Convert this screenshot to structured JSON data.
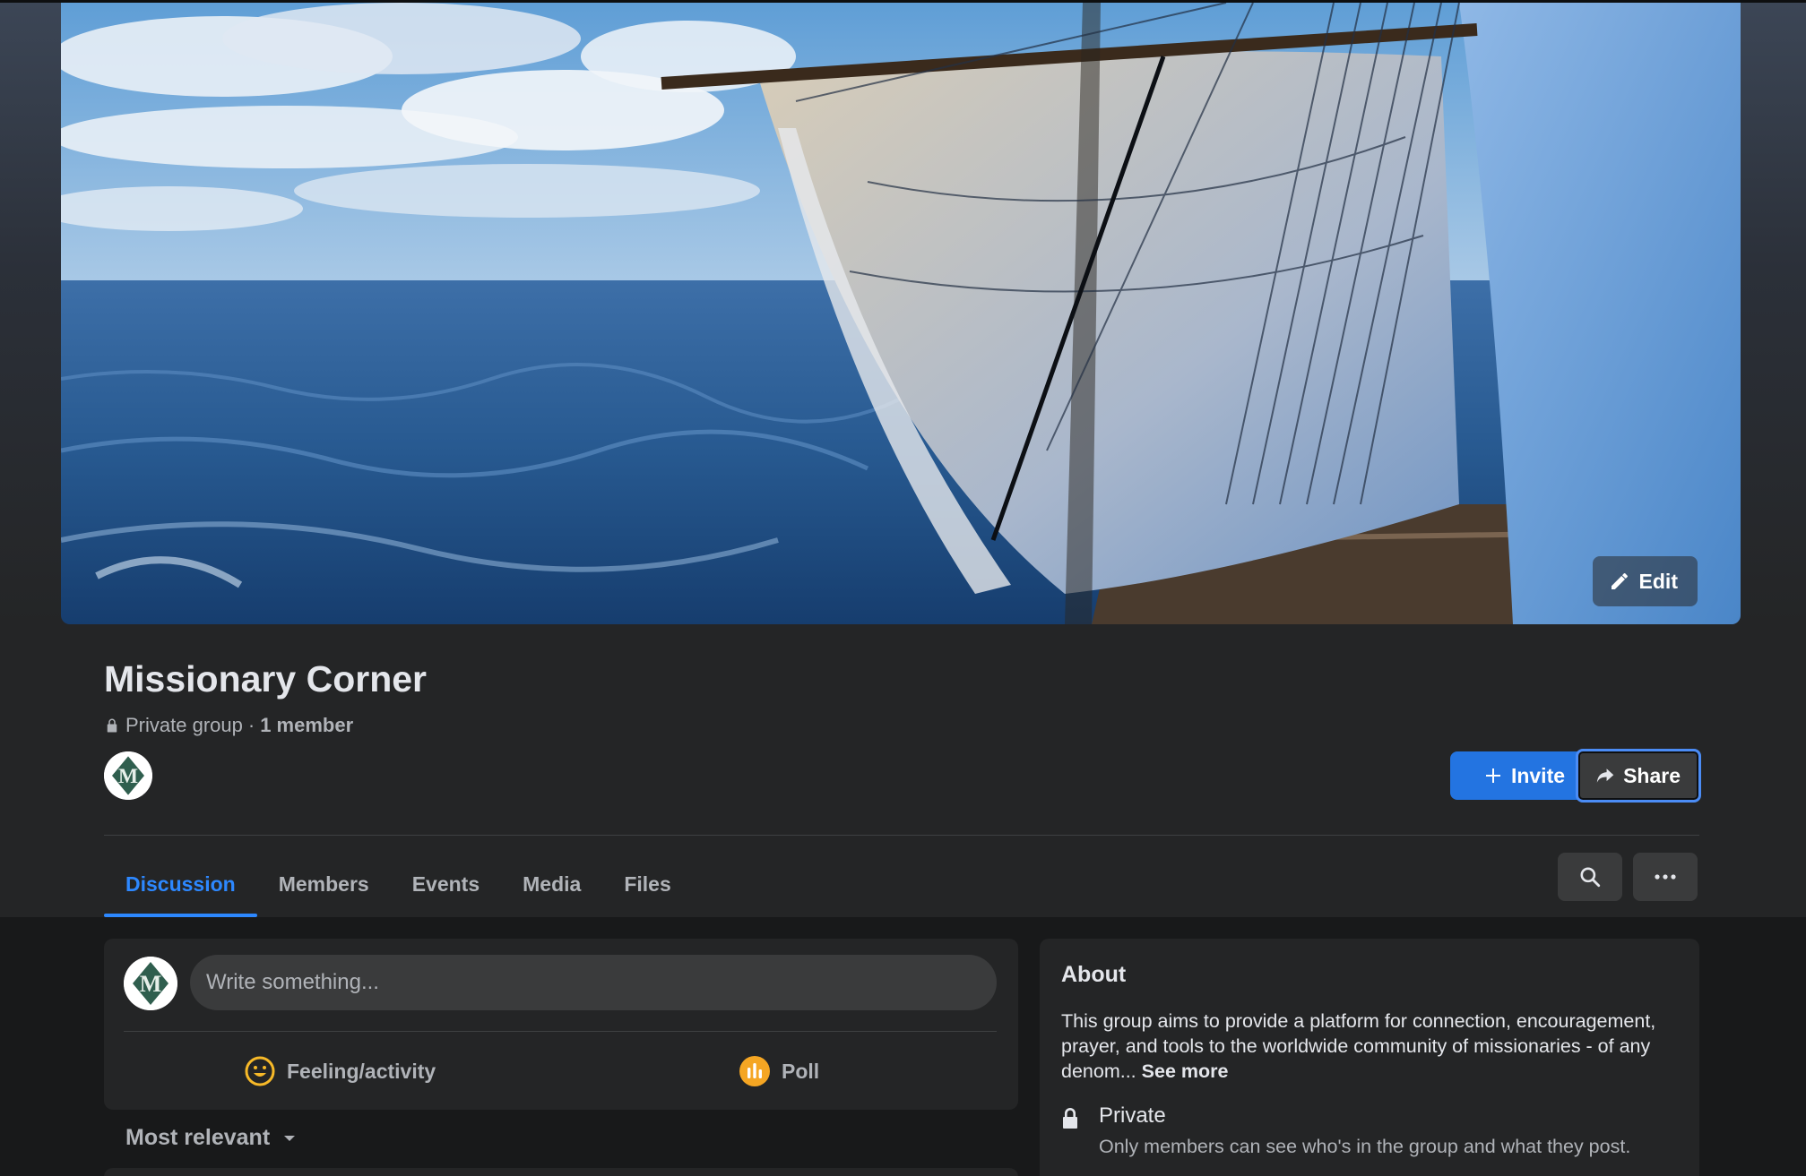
{
  "cover": {
    "edit_label": "Edit"
  },
  "group": {
    "name": "Missionary Corner",
    "privacy": "Private group",
    "separator": "·",
    "member_count": "1 member",
    "avatar_letter": "M"
  },
  "actions": {
    "invite_label": "Invite",
    "share_label": "Share"
  },
  "tabs": [
    {
      "label": "Discussion",
      "active": true
    },
    {
      "label": "Members",
      "active": false
    },
    {
      "label": "Events",
      "active": false
    },
    {
      "label": "Media",
      "active": false
    },
    {
      "label": "Files",
      "active": false
    }
  ],
  "composer": {
    "placeholder": "Write something...",
    "feeling_label": "Feeling/activity",
    "poll_label": "Poll"
  },
  "feed": {
    "sort_label": "Most relevant"
  },
  "about": {
    "title": "About",
    "description": "This group aims to provide a platform for connection, encouragement, prayer, and tools to the worldwide community of missionaries - of any denom...",
    "see_more": "See more",
    "privacy_title": "Private",
    "privacy_desc": "Only members can see who's in the group and what they post."
  },
  "colors": {
    "accent": "#2d88ff",
    "invite_button": "#2374e1",
    "card": "#242526",
    "background": "#18191a",
    "feeling_icon": "#f7b928",
    "poll_icon": "#f5a623"
  }
}
